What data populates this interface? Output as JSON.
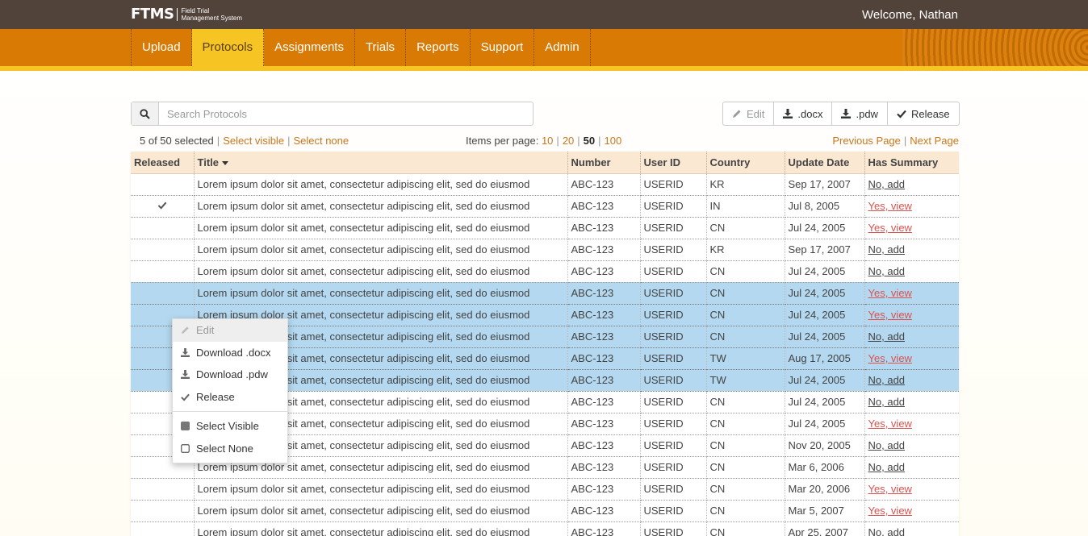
{
  "app": {
    "logo": "FTMS",
    "logo_subtitle_line1": "Field Trial",
    "logo_subtitle_line2": "Management System",
    "welcome": "Welcome, Nathan"
  },
  "nav": [
    {
      "label": "Upload",
      "active": false
    },
    {
      "label": "Protocols",
      "active": true
    },
    {
      "label": "Assignments",
      "active": false
    },
    {
      "label": "Trials",
      "active": false
    },
    {
      "label": "Reports",
      "active": false
    },
    {
      "label": "Support",
      "active": false
    },
    {
      "label": "Admin",
      "active": false
    }
  ],
  "search": {
    "placeholder": "Search Protocols",
    "value": "",
    "icon": "search-icon"
  },
  "toolbar": {
    "edit": "Edit",
    "docx": ".docx",
    "pdw": ".pdw",
    "release": "Release"
  },
  "selection": {
    "count_text": "5 of 50 selected",
    "select_visible": "Select visible",
    "select_none": "Select none"
  },
  "pagination": {
    "items_per_page_label": "Items per page:",
    "options": [
      "10",
      "20",
      "50",
      "100"
    ],
    "current": "50",
    "previous": "Previous Page",
    "next": "Next Page"
  },
  "table": {
    "columns": [
      "Released",
      "Title",
      "Number",
      "User ID",
      "Country",
      "Update Date",
      "Has Summary"
    ],
    "rows": [
      {
        "released": false,
        "title": "Lorem ipsum dolor sit amet, consectetur adipiscing elit, sed do eiusmod",
        "number": "ABC-123",
        "user": "USERID",
        "country": "KR",
        "date": "Sep 17, 2007",
        "summary": "No, add",
        "has": false,
        "selected": false
      },
      {
        "released": true,
        "title": "Lorem ipsum dolor sit amet, consectetur adipiscing elit, sed do eiusmod",
        "number": "ABC-123",
        "user": "USERID",
        "country": "IN",
        "date": "Jul 8, 2005",
        "summary": "Yes, view",
        "has": true,
        "selected": false
      },
      {
        "released": false,
        "title": "Lorem ipsum dolor sit amet, consectetur adipiscing elit, sed do eiusmod",
        "number": "ABC-123",
        "user": "USERID",
        "country": "CN",
        "date": "Jul 24, 2005",
        "summary": "Yes, view",
        "has": true,
        "selected": false
      },
      {
        "released": false,
        "title": "Lorem ipsum dolor sit amet, consectetur adipiscing elit, sed do eiusmod",
        "number": "ABC-123",
        "user": "USERID",
        "country": "KR",
        "date": "Sep 17, 2007",
        "summary": "No, add",
        "has": false,
        "selected": false
      },
      {
        "released": false,
        "title": "Lorem ipsum dolor sit amet, consectetur adipiscing elit, sed do eiusmod",
        "number": "ABC-123",
        "user": "USERID",
        "country": "CN",
        "date": "Jul 24, 2005",
        "summary": "No, add",
        "has": false,
        "selected": false
      },
      {
        "released": false,
        "title": "Lorem ipsum dolor sit amet, consectetur adipiscing elit, sed do eiusmod",
        "number": "ABC-123",
        "user": "USERID",
        "country": "CN",
        "date": "Jul 24, 2005",
        "summary": "Yes, view",
        "has": true,
        "selected": true
      },
      {
        "released": false,
        "title": "Lorem ipsum dolor sit amet, consectetur adipiscing elit, sed do eiusmod",
        "number": "ABC-123",
        "user": "USERID",
        "country": "CN",
        "date": "Jul 24, 2005",
        "summary": "Yes, view",
        "has": true,
        "selected": true
      },
      {
        "released": false,
        "title": "Lorem ipsum dolor sit amet, consectetur adipiscing elit, sed do eiusmod",
        "number": "ABC-123",
        "user": "USERID",
        "country": "CN",
        "date": "Jul 24, 2005",
        "summary": "No, add",
        "has": false,
        "selected": true
      },
      {
        "released": false,
        "title": "Lorem ipsum dolor sit amet, consectetur adipiscing elit, sed do eiusmod",
        "number": "ABC-123",
        "user": "USERID",
        "country": "TW",
        "date": "Aug 17, 2005",
        "summary": "Yes, view",
        "has": true,
        "selected": true
      },
      {
        "released": false,
        "title": "Lorem ipsum dolor sit amet, consectetur adipiscing elit, sed do eiusmod",
        "number": "ABC-123",
        "user": "USERID",
        "country": "TW",
        "date": "Jul 24, 2005",
        "summary": "No, add",
        "has": false,
        "selected": true
      },
      {
        "released": false,
        "title": "Lorem ipsum dolor sit amet, consectetur adipiscing elit, sed do eiusmod",
        "number": "ABC-123",
        "user": "USERID",
        "country": "CN",
        "date": "Jul 24, 2005",
        "summary": "No, add",
        "has": false,
        "selected": false
      },
      {
        "released": false,
        "title": "Lorem ipsum dolor sit amet, consectetur adipiscing elit, sed do eiusmod",
        "number": "ABC-123",
        "user": "USERID",
        "country": "CN",
        "date": "Jul 24, 2005",
        "summary": "Yes, view",
        "has": true,
        "selected": false
      },
      {
        "released": false,
        "title": "Lorem ipsum dolor sit amet, consectetur adipiscing elit, sed do eiusmod",
        "number": "ABC-123",
        "user": "USERID",
        "country": "CN",
        "date": "Nov 20, 2005",
        "summary": "No, add",
        "has": false,
        "selected": false
      },
      {
        "released": false,
        "title": "Lorem ipsum dolor sit amet, consectetur adipiscing elit, sed do eiusmod",
        "number": "ABC-123",
        "user": "USERID",
        "country": "CN",
        "date": "Mar 6, 2006",
        "summary": "No, add",
        "has": false,
        "selected": false
      },
      {
        "released": false,
        "title": "Lorem ipsum dolor sit amet, consectetur adipiscing elit, sed do eiusmod",
        "number": "ABC-123",
        "user": "USERID",
        "country": "CN",
        "date": "Mar 20, 2006",
        "summary": "Yes, view",
        "has": true,
        "selected": false
      },
      {
        "released": false,
        "title": "Lorem ipsum dolor sit amet, consectetur adipiscing elit, sed do eiusmod",
        "number": "ABC-123",
        "user": "USERID",
        "country": "CN",
        "date": "Mar 5, 2007",
        "summary": "Yes, view",
        "has": true,
        "selected": false
      },
      {
        "released": false,
        "title": "Lorem ipsum dolor sit amet, consectetur adipiscing elit, sed do eiusmod",
        "number": "ABC-123",
        "user": "USERID",
        "country": "CN",
        "date": "Apr 25, 2007",
        "summary": "No, add",
        "has": false,
        "selected": false
      }
    ]
  },
  "context_menu": {
    "edit": "Edit",
    "download_docx": "Download .docx",
    "download_pdw": "Download .pdw",
    "release": "Release",
    "select_visible": "Select Visible",
    "select_none": "Select None"
  },
  "colors": {
    "topbar": "#51423a",
    "nav": "#d97a05",
    "nav_active": "#f6c524",
    "accent_link": "#c8771b",
    "selected_row": "#b3d8ef",
    "yes_link": "#d9534f"
  }
}
